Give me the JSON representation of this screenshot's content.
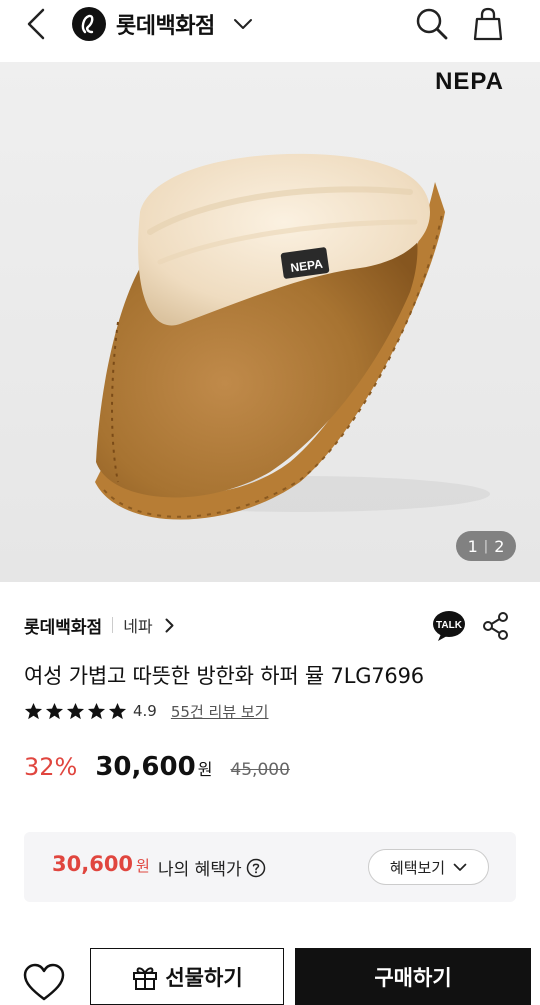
{
  "header": {
    "brand_name": "롯데백화점",
    "icons": [
      "back-icon",
      "lotte-logo-icon",
      "chevron-down-icon",
      "search-icon",
      "shopping-bag-icon"
    ]
  },
  "gallery": {
    "brand_logo_text": "NEPA",
    "label_text": "NEPA",
    "current_page": "1",
    "total_pages": "2"
  },
  "seller": {
    "store_name": "롯데백화점",
    "brand_name": "네파",
    "talk_label": "TALK"
  },
  "product": {
    "title": "여성 가볍고 따뜻한 방한화 하퍼 뮬 7LG7696",
    "rating": "4.9",
    "stars_filled": 5,
    "review_link": "55건 리뷰 보기"
  },
  "price": {
    "discount": "32%",
    "sale_price": "30,600",
    "unit": "원",
    "original_price": "45,000"
  },
  "benefit": {
    "price": "30,600",
    "unit": "원",
    "label": "나의 혜택가",
    "button_label": "혜택보기"
  },
  "actions": {
    "gift_label": "선물하기",
    "buy_label": "구매하기"
  },
  "colors": {
    "accent_red": "#e0463f",
    "primary_dark": "#111111",
    "benefit_bg": "#f5f5f7"
  }
}
